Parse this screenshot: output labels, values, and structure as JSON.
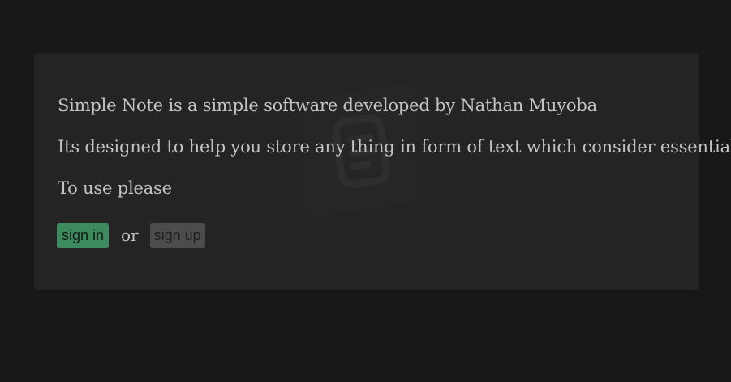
{
  "intro": {
    "line1": "Simple Note is a simple software developed by Nathan Muyoba",
    "line2": "Its designed to help you store any thing in form of text which consider essential",
    "line3": "To use please"
  },
  "actions": {
    "sign_in_label": "sign in",
    "or_label": "or",
    "sign_up_label": "sign up"
  },
  "colors": {
    "page_background": "#181818",
    "card_background": "#242424",
    "text": "#c4c4c4",
    "sign_in_button": "#3e8a5f",
    "sign_up_button": "#4c4c4c"
  },
  "icons": {
    "watermark": "note-document-icon"
  }
}
